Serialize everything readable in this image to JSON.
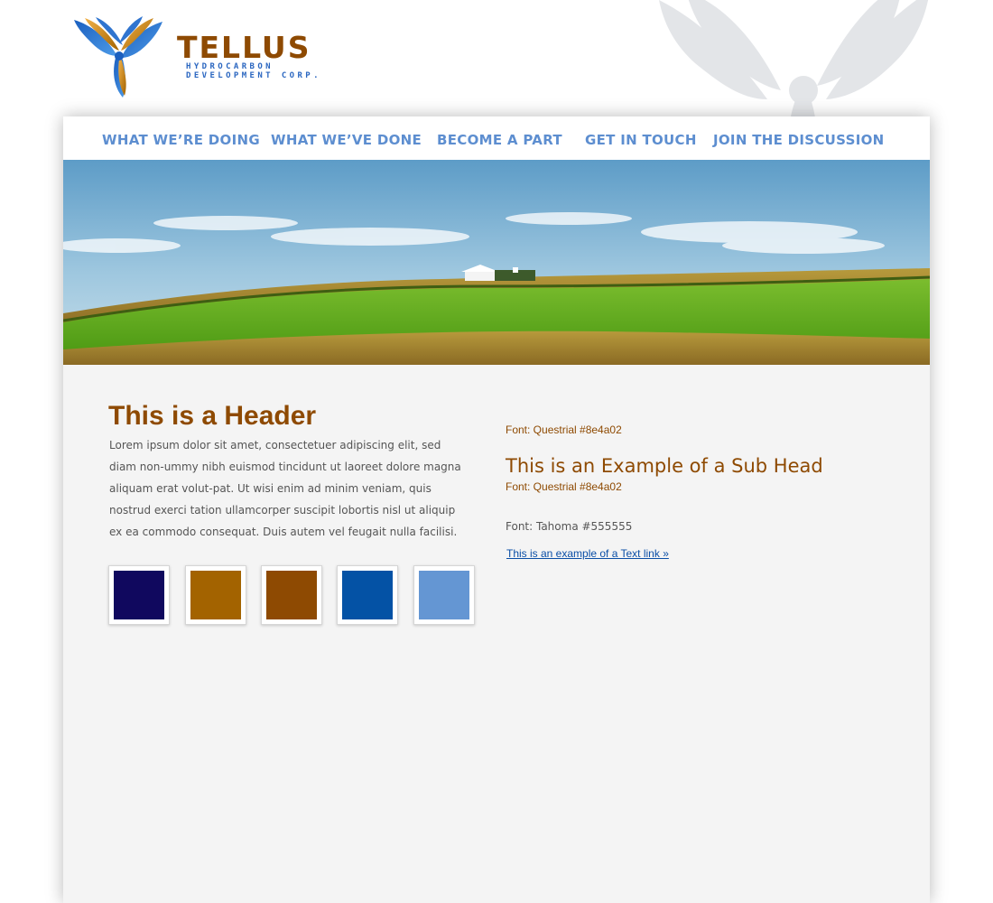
{
  "brand": {
    "name": "TELLUS",
    "subline_1": "HYDROCARBON",
    "subline_2": "DEVELOPMENT CORP.",
    "color_brown": "#8e4a02",
    "color_blue": "#2a66c0"
  },
  "nav": {
    "items": [
      {
        "label": "WHAT WE’RE DOING"
      },
      {
        "label": "WHAT WE’VE DONE"
      },
      {
        "label": "BECOME A PART"
      },
      {
        "label": "GET IN TOUCH"
      },
      {
        "label": "JOIN THE DISCUSSION"
      }
    ],
    "color": "#5d8ed0"
  },
  "hero": {
    "icon": "farm-landscape-image"
  },
  "main": {
    "header": "This is a Header",
    "body": "Lorem ipsum dolor sit amet, consectetuer adipiscing elit, sed diam non-ummy nibh euismod tincidunt ut laoreet dolore magna aliquam erat volut-pat. Ut wisi enim ad minim veniam, quis nostrud exerci tation ullamcorper suscipit lobortis nisl ut aliquip ex ea commodo consequat. Duis autem vel feugait nulla facilisi.",
    "swatches": [
      "#10085e",
      "#a36300",
      "#8e4a02",
      "#0452a5",
      "#6496d3"
    ]
  },
  "style_guide": {
    "font_note_1": "Font: Questrial #8e4a02",
    "sub_head": "This is an Example of a Sub Head",
    "font_note_2": "Font: Questrial #8e4a02",
    "tahoma_note": "Font: Tahoma #555555",
    "text_link": "This is an example of a Text link »",
    "text_color": "#555555",
    "link_color": "#0a4ea6"
  }
}
